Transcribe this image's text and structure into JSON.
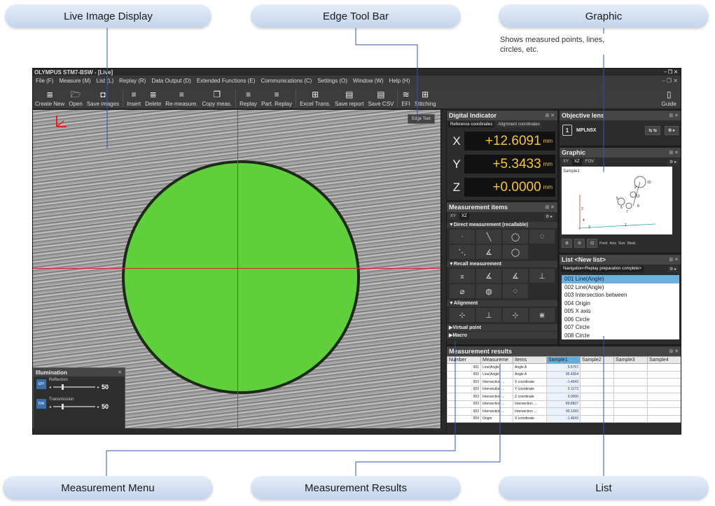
{
  "callouts": {
    "live_image_display": "Live Image Display",
    "edge_tool_bar": "Edge Tool Bar",
    "graphic": "Graphic",
    "graphic_note": "Shows measured points, lines, circles, etc.",
    "measurement_menu": "Measurement Menu",
    "measurement_results": "Measurement Results",
    "list": "List"
  },
  "window": {
    "title": "OLYMPUS   STM7-BSW - [Live]",
    "controls": "– ❐ ✕",
    "menu_window_controls": "– ❐ ✕"
  },
  "menu": [
    "File (F)",
    "Measure (M)",
    "List (L)",
    "Replay (R)",
    "Data Output (D)",
    "Extended Functions (E)",
    "Communications (C)",
    "Settings (O)",
    "Window (W)",
    "Help (H)"
  ],
  "toolbar": {
    "create_new": "Create New",
    "open": "Open",
    "save_images": "Save images",
    "insert": "Insert",
    "delete": "Delete",
    "remeasure": "Re-measure.",
    "copy_meas": "Copy meas.",
    "replay": "Replay",
    "part_replay": "Part. Replay",
    "excel_trans": "Excel Trans.",
    "save_report": "Save report",
    "save_csv": "Save CSV",
    "efi": "EFI",
    "stitching": "Stitching",
    "guide": "Guide"
  },
  "live": {
    "edge_tool": "Edge Tool"
  },
  "illumination": {
    "title": "Illumination",
    "reflection_label": "Reflection",
    "reflection_icon": "EPI",
    "reflection_value": "50",
    "transmission_label": "Transmission",
    "transmission_icon": "DIA",
    "transmission_value": "50"
  },
  "digital_indicator": {
    "title": "Digital Indicator",
    "tab_ref": "Reference coordinates",
    "tab_align": "Alignment coordinates",
    "x_label": "X",
    "x_value": "+12.6091",
    "x_unit": "mm",
    "y_label": "Y",
    "y_value": "+5.3433",
    "y_unit": "mm",
    "z_label": "Z",
    "z_value": "+0.0000",
    "z_unit": "mm"
  },
  "measurement_items": {
    "title": "Measurement items",
    "tab_xy": "XY",
    "tab_xz": "XZ",
    "direct": "▼Direct measurement (recallable)",
    "recall": "▼Recall measurement",
    "alignment": "▼Alignment",
    "virtual": "▶Virtual point",
    "macro": "▶Macro",
    "direct_icons": [
      "·",
      "╲",
      "◯",
      "◌",
      "⋱",
      "∡",
      "◯"
    ],
    "recall_icons": [
      "⌅",
      "∡",
      "∡",
      "⊥",
      "⌀",
      "◍",
      "◌"
    ],
    "align_icons": [
      "⊹",
      "⊥",
      "⊹",
      "⋇"
    ]
  },
  "objective_lens": {
    "title": "Objective lens",
    "lens_num": "1",
    "lens_name": "MPLN5X"
  },
  "graphic_panel": {
    "title": "Graphic",
    "tab_xy": "XY",
    "tab_xz": "XZ",
    "tab_fov": "FOV",
    "sample": "Sample1",
    "point": "Point",
    "axis": "Axis",
    "size": "Size",
    "mask": "Mask",
    "labels": [
      "10",
      "9",
      "12",
      "8",
      "7",
      "6",
      "5",
      "4",
      "3",
      "2",
      "1"
    ]
  },
  "list_panel": {
    "title": "List <New list>",
    "nav": "Navigation<Replay preparation complete>",
    "items": [
      "001  Line(Angle)",
      "002  Line(Angle)",
      "003  Intersection between",
      "004  Origin",
      "005  X axis",
      "006  Circle",
      "007  Circle",
      "008  Circle"
    ]
  },
  "results": {
    "title": "Measurement results",
    "headers": [
      "Number",
      "Measureme",
      "Items",
      "Sample1",
      "Sample2",
      "Sample3",
      "Sample4"
    ],
    "rows": [
      [
        "001",
        "Line(Angle)",
        "Angle A",
        "5.5757"
      ],
      [
        "002",
        "Line(Angle)",
        "Angle A",
        "95.4364"
      ],
      [
        "003",
        "Intersection ...",
        "X coordinate",
        "-1.4643"
      ],
      [
        "003",
        "Intersection ...",
        "Y coordinate",
        "0.1272"
      ],
      [
        "003",
        "Intersection ...",
        "Z coordinate",
        "0.0000"
      ],
      [
        "003",
        "Intersection ...",
        "Intersection ...",
        "89.8607"
      ],
      [
        "003",
        "Intersection ...",
        "Intersection ...",
        "90.1393"
      ],
      [
        "004",
        "Origin",
        "X coordinate",
        "-1.4643"
      ]
    ]
  }
}
